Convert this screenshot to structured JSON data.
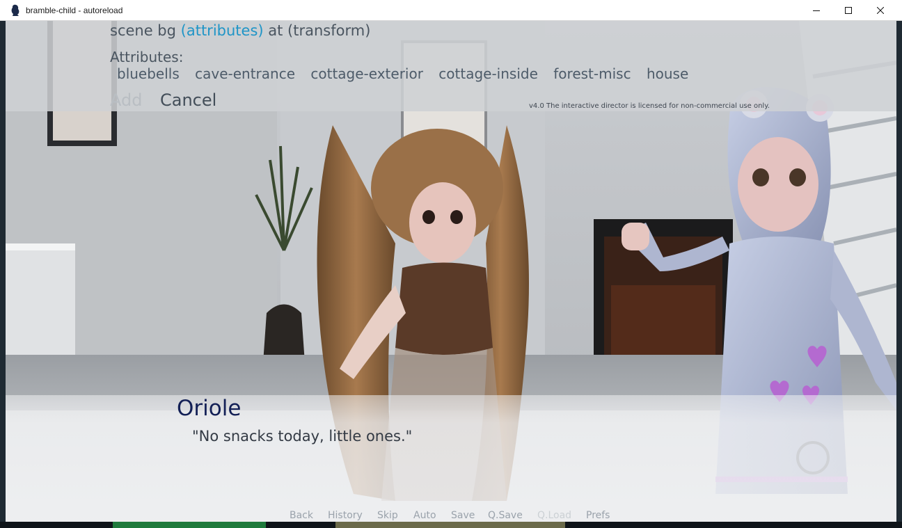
{
  "window": {
    "title": "bramble-child - autoreload",
    "controls": [
      "minimize-icon",
      "maximize-icon",
      "close-icon"
    ]
  },
  "director": {
    "command_prefix": "scene bg ",
    "command_link": "(attributes)",
    "command_suffix": " at (transform)",
    "attributes_label": "Attributes:",
    "attributes": [
      "bluebells",
      "cave-entrance",
      "cottage-exterior",
      "cottage-inside",
      "forest-misc",
      "house"
    ],
    "add_label": "Add",
    "cancel_label": "Cancel",
    "license_text": "v4.0   The interactive director is licensed for non-commercial use only."
  },
  "dialogue": {
    "speaker": "Oriole",
    "text": "\"No snacks today, little ones.\""
  },
  "quick_menu": [
    {
      "label": "Back",
      "enabled": true
    },
    {
      "label": "History",
      "enabled": true
    },
    {
      "label": "Skip",
      "enabled": true
    },
    {
      "label": "Auto",
      "enabled": true
    },
    {
      "label": "Save",
      "enabled": true
    },
    {
      "label": "Q.Save",
      "enabled": true
    },
    {
      "label": "Q.Load",
      "enabled": false
    },
    {
      "label": "Prefs",
      "enabled": true
    }
  ],
  "colors": {
    "link": "#1f95c7",
    "speaker": "#132056",
    "dialogue_text": "#333a44",
    "director_panel": "#ced1d4"
  }
}
